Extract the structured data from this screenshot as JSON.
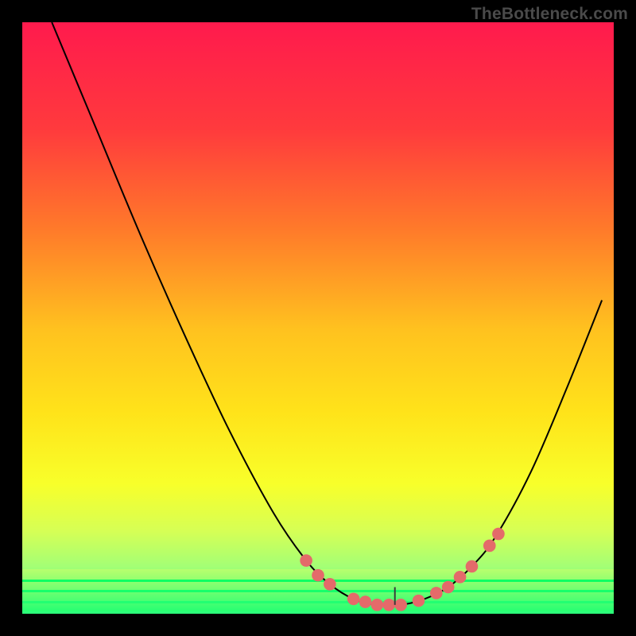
{
  "watermark": {
    "text": "TheBottleneck.com"
  },
  "chart_data": {
    "type": "line",
    "title": "",
    "xlabel": "",
    "ylabel": "",
    "xlim": [
      0,
      100
    ],
    "ylim": [
      0,
      100
    ],
    "gradient_stops": [
      {
        "offset": 0,
        "color": "#ff1a4d"
      },
      {
        "offset": 18,
        "color": "#ff3a3d"
      },
      {
        "offset": 35,
        "color": "#ff7a2a"
      },
      {
        "offset": 52,
        "color": "#ffc21f"
      },
      {
        "offset": 66,
        "color": "#ffe31a"
      },
      {
        "offset": 78,
        "color": "#f8ff2a"
      },
      {
        "offset": 86,
        "color": "#d6ff55"
      },
      {
        "offset": 92,
        "color": "#a4ff75"
      },
      {
        "offset": 100,
        "color": "#2cff7a"
      }
    ],
    "green_bar": {
      "top_pct": 92.5,
      "color_top": "#b8ff6e",
      "color_bottom": "#1fff73",
      "rule_colors": [
        "#2cff7a",
        "#22ff72",
        "#17ff6b",
        "#0eff63"
      ]
    },
    "series": [
      {
        "name": "bottleneck-curve",
        "type": "line",
        "color": "#000000",
        "width": 2,
        "points": [
          {
            "x": 5,
            "y": 100
          },
          {
            "x": 12.5,
            "y": 82
          },
          {
            "x": 20,
            "y": 64
          },
          {
            "x": 27.5,
            "y": 47
          },
          {
            "x": 35,
            "y": 31
          },
          {
            "x": 42.5,
            "y": 17
          },
          {
            "x": 48,
            "y": 9
          },
          {
            "x": 52,
            "y": 5
          },
          {
            "x": 56,
            "y": 2.5
          },
          {
            "x": 60,
            "y": 1.5
          },
          {
            "x": 64,
            "y": 1.5
          },
          {
            "x": 68,
            "y": 2.5
          },
          {
            "x": 72,
            "y": 4.5
          },
          {
            "x": 76,
            "y": 8
          },
          {
            "x": 80,
            "y": 13
          },
          {
            "x": 86,
            "y": 24
          },
          {
            "x": 92,
            "y": 38
          },
          {
            "x": 98,
            "y": 53
          }
        ]
      },
      {
        "name": "markers",
        "type": "scatter",
        "color": "#e46a6a",
        "radius": 8,
        "points": [
          {
            "x": 48,
            "y": 9
          },
          {
            "x": 50,
            "y": 6.5
          },
          {
            "x": 52,
            "y": 5
          },
          {
            "x": 56,
            "y": 2.5
          },
          {
            "x": 58,
            "y": 2
          },
          {
            "x": 60,
            "y": 1.5
          },
          {
            "x": 62,
            "y": 1.5
          },
          {
            "x": 64,
            "y": 1.5
          },
          {
            "x": 67,
            "y": 2.2
          },
          {
            "x": 70,
            "y": 3.5
          },
          {
            "x": 72,
            "y": 4.5
          },
          {
            "x": 74,
            "y": 6.2
          },
          {
            "x": 76,
            "y": 8
          },
          {
            "x": 79,
            "y": 11.5
          },
          {
            "x": 80.5,
            "y": 13.5
          }
        ]
      }
    ],
    "tick": {
      "x": 63,
      "y_from": 1.5,
      "y_to": 4.5,
      "color": "#3a3a3a",
      "width": 2
    }
  }
}
